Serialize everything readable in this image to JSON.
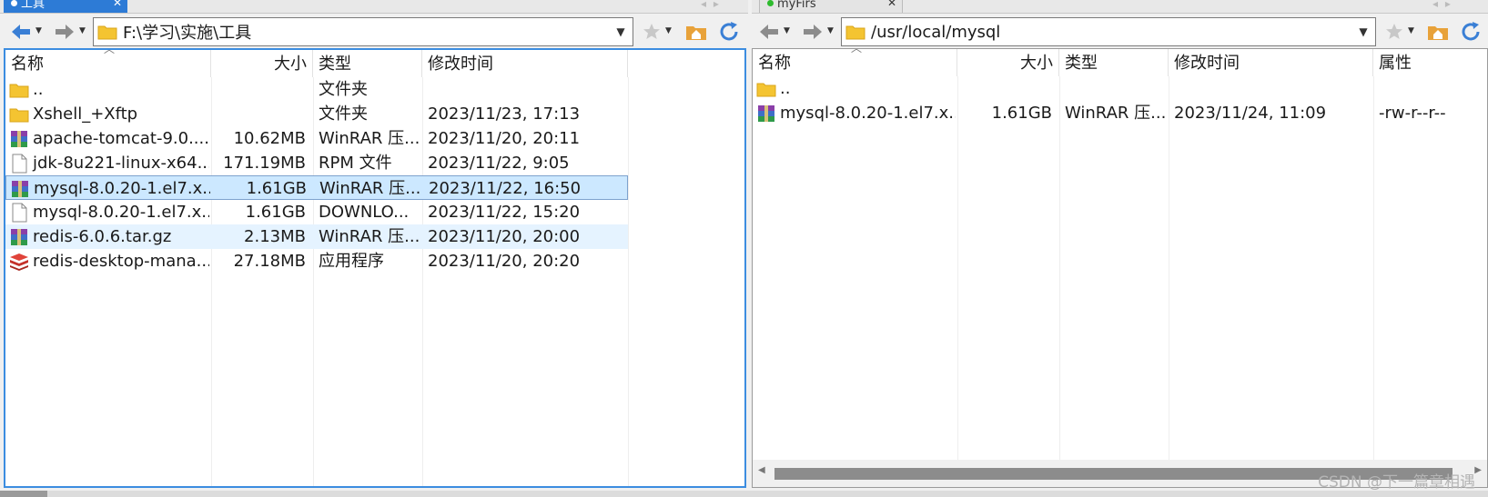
{
  "left_pane": {
    "tab_label": "工具",
    "address": "F:\\学习\\实施\\工具",
    "columns": [
      "名称",
      "大小",
      "类型",
      "修改时间"
    ],
    "rows": [
      {
        "icon": "folder-icon",
        "name": "..",
        "size": "",
        "type": "文件夹",
        "modified": ""
      },
      {
        "icon": "folder-icon",
        "name": "Xshell_+Xftp",
        "size": "",
        "type": "文件夹",
        "modified": "2023/11/23, 17:13"
      },
      {
        "icon": "winrar-archive-icon",
        "name": "apache-tomcat-9.0....",
        "size": "10.62MB",
        "type": "WinRAR 压...",
        "modified": "2023/11/20, 20:11"
      },
      {
        "icon": "blank-file-icon",
        "name": "jdk-8u221-linux-x64...",
        "size": "171.19MB",
        "type": "RPM 文件",
        "modified": "2023/11/22, 9:05"
      },
      {
        "icon": "winrar-archive-icon",
        "name": "mysql-8.0.20-1.el7.x...",
        "size": "1.61GB",
        "type": "WinRAR 压...",
        "modified": "2023/11/22, 16:50"
      },
      {
        "icon": "blank-file-icon",
        "name": "mysql-8.0.20-1.el7.x...",
        "size": "1.61GB",
        "type": "DOWNLO...",
        "modified": "2023/11/22, 15:20"
      },
      {
        "icon": "winrar-archive-icon",
        "name": "redis-6.0.6.tar.gz",
        "size": "2.13MB",
        "type": "WinRAR 压...",
        "modified": "2023/11/20, 20:00"
      },
      {
        "icon": "redis-app-icon",
        "name": "redis-desktop-mana...",
        "size": "27.18MB",
        "type": "应用程序",
        "modified": "2023/11/20, 20:20"
      }
    ]
  },
  "right_pane": {
    "tab_label": "myFirs",
    "address": "/usr/local/mysql",
    "columns": [
      "名称",
      "大小",
      "类型",
      "修改时间",
      "属性"
    ],
    "rows": [
      {
        "icon": "folder-icon",
        "name": "..",
        "size": "",
        "type": "",
        "modified": "",
        "attributes": ""
      },
      {
        "icon": "winrar-archive-icon",
        "name": "mysql-8.0.20-1.el7.x...",
        "size": "1.61GB",
        "type": "WinRAR 压...",
        "modified": "2023/11/24, 11:09",
        "attributes": "-rw-r--r--"
      }
    ]
  },
  "watermark": "CSDN @下一篇章相遇",
  "colors": {
    "selection": "#cce8ff",
    "hover": "#e5f3ff",
    "active_tab": "#2d7bd6",
    "active_border": "#3c8de0"
  }
}
